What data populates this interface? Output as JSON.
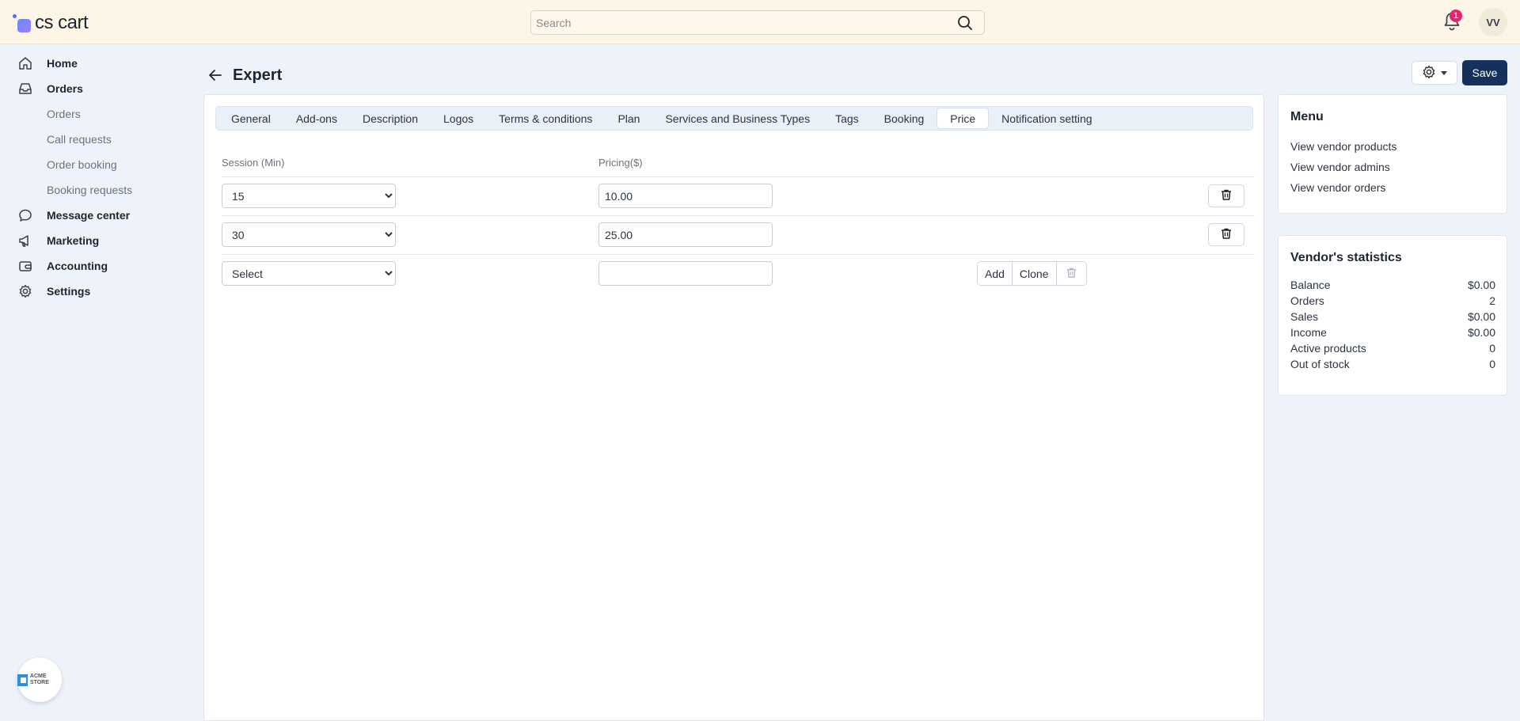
{
  "app": {
    "logo_text": "cs cart"
  },
  "search": {
    "placeholder": "Search"
  },
  "notifications": {
    "count": "1"
  },
  "user": {
    "initials": "VV"
  },
  "sidebar": {
    "items": [
      {
        "label": "Home",
        "icon": "home-icon"
      },
      {
        "label": "Orders",
        "icon": "inbox-icon"
      },
      {
        "label": "Message center",
        "icon": "chat-icon"
      },
      {
        "label": "Marketing",
        "icon": "megaphone-icon"
      },
      {
        "label": "Accounting",
        "icon": "wallet-icon"
      },
      {
        "label": "Settings",
        "icon": "gear-icon"
      }
    ],
    "orders_sub": [
      "Orders",
      "Call requests",
      "Order booking",
      "Booking requests"
    ],
    "store_label": "ACME STORE"
  },
  "page": {
    "title": "Expert",
    "save_label": "Save"
  },
  "tabs": [
    {
      "label": "General"
    },
    {
      "label": "Add-ons"
    },
    {
      "label": "Description"
    },
    {
      "label": "Logos"
    },
    {
      "label": "Terms & conditions"
    },
    {
      "label": "Plan"
    },
    {
      "label": "Services and Business Types"
    },
    {
      "label": "Tags"
    },
    {
      "label": "Booking"
    },
    {
      "label": "Price",
      "active": true
    },
    {
      "label": "Notification setting"
    }
  ],
  "pricing": {
    "headers": {
      "session": "Session (Min)",
      "price": "Pricing($)"
    },
    "rows": [
      {
        "session": "15",
        "price": "10.00"
      },
      {
        "session": "30",
        "price": "25.00"
      }
    ],
    "new_row": {
      "session": "Select",
      "price": ""
    },
    "add_label": "Add",
    "clone_label": "Clone"
  },
  "menu_card": {
    "title": "Menu",
    "links": [
      "View vendor products",
      "View vendor admins",
      "View vendor orders"
    ]
  },
  "stats_card": {
    "title": "Vendor's statistics",
    "rows": [
      {
        "label": "Balance",
        "value": "$0.00"
      },
      {
        "label": "Orders",
        "value": "2"
      },
      {
        "label": "Sales",
        "value": "$0.00"
      },
      {
        "label": "Income",
        "value": "$0.00"
      },
      {
        "label": "Active products",
        "value": "0"
      },
      {
        "label": "Out of stock",
        "value": "0"
      }
    ]
  },
  "colors": {
    "accent": "#15305a",
    "topbar_bg": "#fdf5e6",
    "badge": "#e6246e"
  }
}
